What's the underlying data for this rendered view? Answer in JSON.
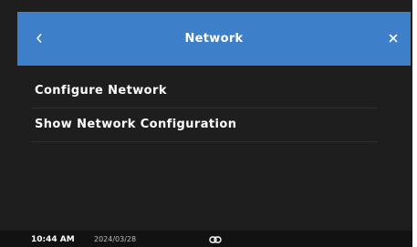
{
  "header": {
    "title": "Network",
    "back_icon": "chevron-left-icon",
    "close_icon": "close-icon"
  },
  "menu": {
    "items": [
      {
        "label": "Configure Network"
      },
      {
        "label": "Show Network Configuration"
      }
    ]
  },
  "status_bar": {
    "time": "10:44 AM",
    "date": "2024/03/28",
    "icon": "link-icon"
  },
  "colors": {
    "header_bg": "#3d7fc9",
    "screen_bg": "#1e1e1e",
    "status_bg": "#121212",
    "text": "#ffffff"
  }
}
